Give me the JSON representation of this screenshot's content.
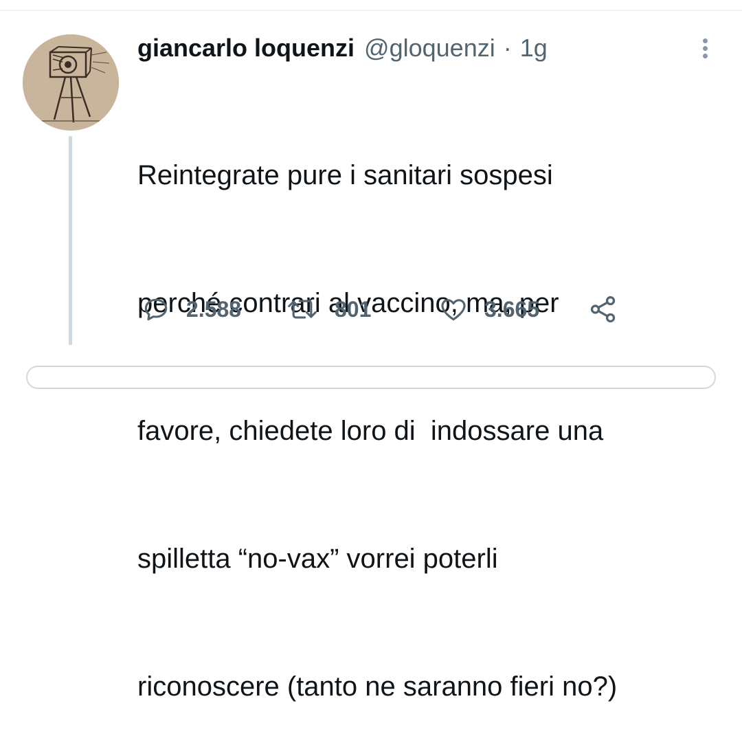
{
  "tweet": {
    "author": {
      "display_name": "giancarlo loquenzi",
      "handle": "@gloquenzi",
      "avatar_icon": "sketch-camera-tripod-avatar"
    },
    "separator": "·",
    "time": "1g",
    "lines": [
      "Reintegrate pure i sanitari sospesi",
      "perché contrari al vaccino, ma, per",
      "favore, chiedete loro di  indossare una",
      "spilletta “no-vax” vorrei poterli",
      "riconoscere (tanto ne saranno fieri no?)"
    ],
    "stats": {
      "replies": "2.588",
      "retweets": "801",
      "likes": "3.665"
    }
  },
  "icons": {
    "more": "more-vertical-icon",
    "reply": "reply-bubble-icon",
    "retweet": "retweet-icon",
    "like": "heart-icon",
    "share": "share-icon"
  },
  "colors": {
    "text": "#0f1419",
    "secondary": "#536471",
    "divider": "#cfd9de",
    "avatar_bg": "#c6b098"
  }
}
